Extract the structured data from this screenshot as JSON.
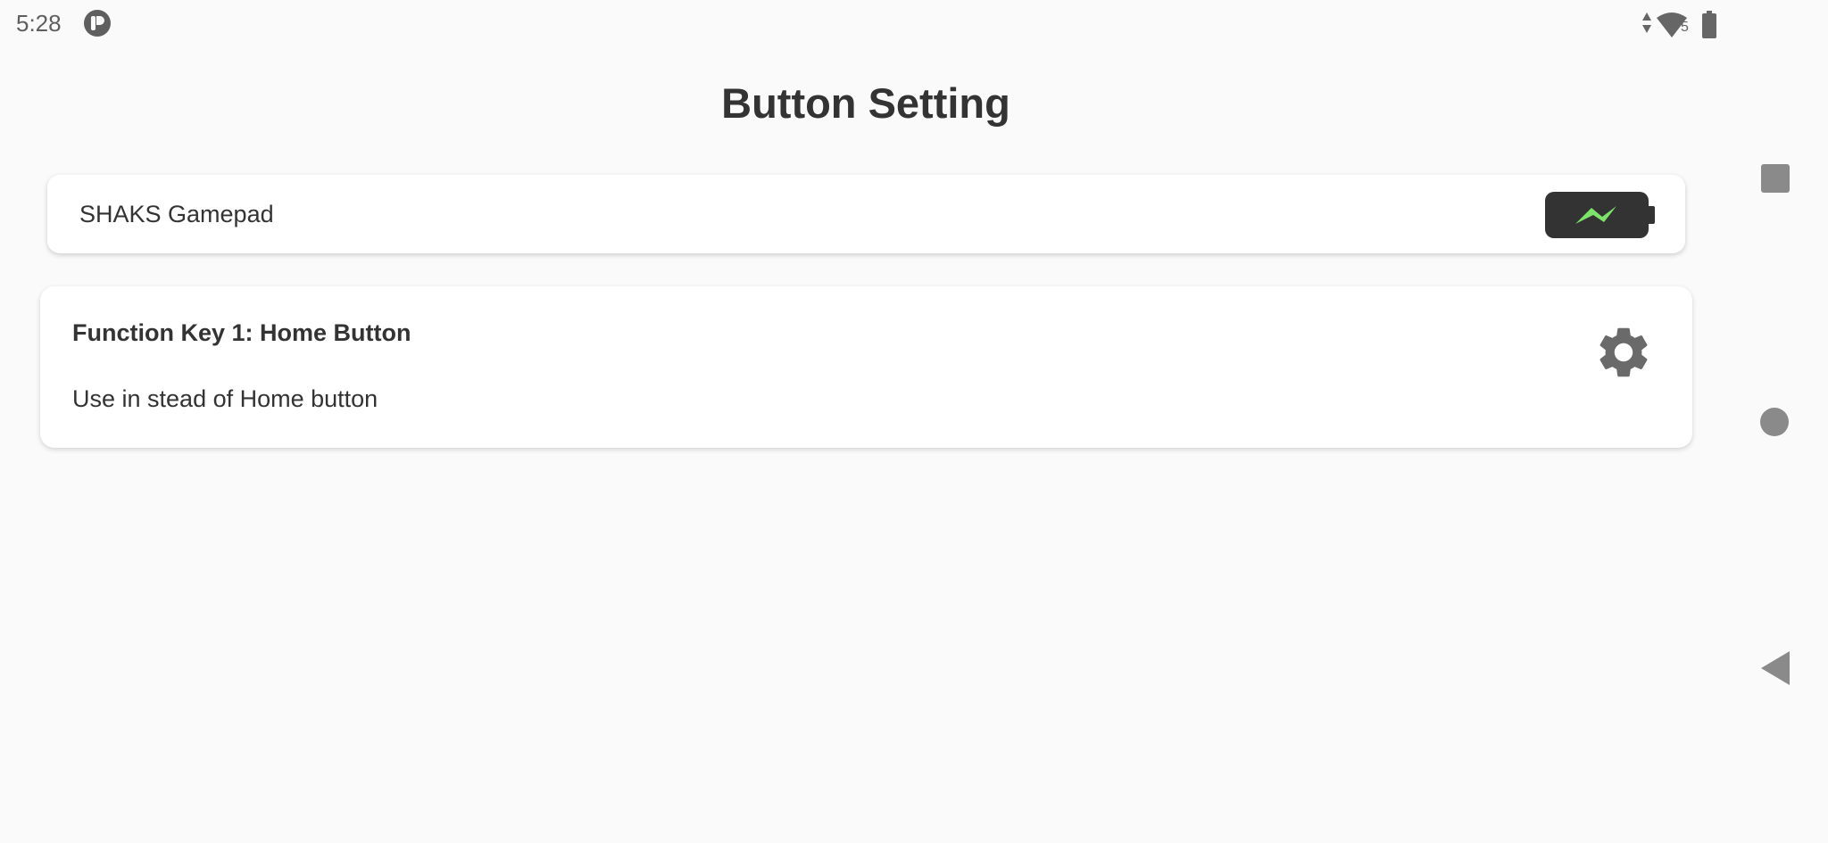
{
  "status_bar": {
    "time": "5:28",
    "app_icon": "pocket-icon",
    "icons": [
      "data-arrows-icon",
      "wifi-icon",
      "battery-icon"
    ],
    "wifi_label": "5"
  },
  "page": {
    "title": "Button Setting"
  },
  "device": {
    "name": "SHAKS Gamepad",
    "battery_icon": "charging-battery-icon",
    "battery_color": "#333333",
    "bolt_color": "#7ee36b"
  },
  "function_key": {
    "title": "Function Key 1: Home Button",
    "description": "Use in stead of Home button",
    "settings_icon": "gear-icon"
  },
  "navigation": {
    "buttons": [
      "recents",
      "home",
      "back"
    ]
  }
}
